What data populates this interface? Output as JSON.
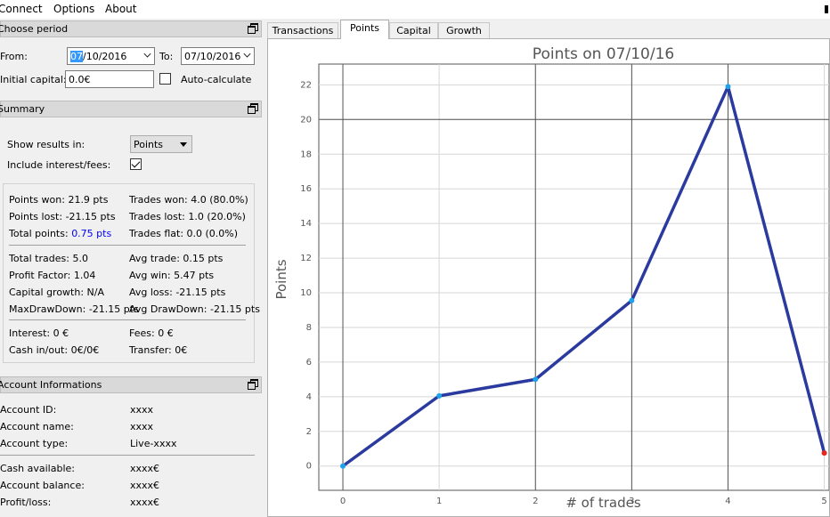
{
  "menu": {
    "items": [
      "Connect",
      "Options",
      "About"
    ]
  },
  "period": {
    "title": "Choose period",
    "from_label": "From:",
    "from_value_selected": "07",
    "from_value_rest": "/10/2016",
    "to_label": "To:",
    "to_value": "07/10/2016",
    "capital_label": "Initial capital:",
    "capital_value": "0.0€",
    "auto_label": "Auto-calculate",
    "auto_checked": false
  },
  "summary": {
    "title": "Summary",
    "show_label": "Show results in:",
    "show_value": "Points",
    "include_label": "Include interest/fees:",
    "include_checked": true,
    "stats": {
      "points_won": "Points won: 21.9 pts",
      "trades_won": "Trades won: 4.0 (80.0%)",
      "points_lost": "Points lost: -21.15 pts",
      "trades_lost": "Trades lost: 1.0 (20.0%)",
      "total_points_label": "Total points:",
      "total_points_value": "0.75 pts",
      "trades_flat": "Trades flat: 0.0 (0.0%)",
      "total_trades": "Total trades: 5.0",
      "avg_trade": "Avg trade: 0.15 pts",
      "profit_factor": "Profit Factor: 1.04",
      "avg_win": "Avg win: 5.47 pts",
      "capital_growth": "Capital growth: N/A",
      "avg_loss": "Avg loss: -21.15 pts",
      "max_drawdown": "MaxDrawDown: -21.15 pts",
      "avg_drawdown": "Avg DrawDown: -21.15 pts",
      "interest": "Interest: 0 €",
      "fees": "Fees: 0 €",
      "cash": "Cash in/out: 0€/0€",
      "transfer": "Transfer: 0€"
    }
  },
  "account": {
    "title": "Account Informations",
    "rows": [
      {
        "label": "Account ID:",
        "value": "xxxx"
      },
      {
        "label": "Account name:",
        "value": "xxxx"
      },
      {
        "label": "Account type:",
        "value": "Live-xxxx"
      }
    ],
    "rows2": [
      {
        "label": "Cash available:",
        "value": "xxxx€"
      },
      {
        "label": "Account balance:",
        "value": "xxxx€"
      },
      {
        "label": "Profit/loss:",
        "value": "xxxx€"
      }
    ]
  },
  "tabs": [
    "Transactions",
    "Points",
    "Capital",
    "Growth"
  ],
  "active_tab": "Points",
  "colors": {
    "line": "#2b3a9e",
    "point": "#1fa2e8",
    "last_point": "#e8251f",
    "selection": "#3399ff",
    "link_blue": "#0000ff"
  },
  "chart_data": {
    "type": "line",
    "title": "Points on 07/10/16",
    "xlabel": "# of trades",
    "ylabel": "Points",
    "x": [
      0,
      1,
      2,
      3,
      4,
      5
    ],
    "y": [
      0,
      4.05,
      5.0,
      9.55,
      21.9,
      0.75
    ],
    "xlim": [
      -0.25,
      5.05
    ],
    "ylim": [
      -1.4,
      23.2
    ],
    "xticks": [
      0,
      1,
      2,
      3,
      4,
      5
    ],
    "yticks": [
      0,
      2,
      4,
      6,
      8,
      10,
      12,
      14,
      16,
      18,
      20,
      22
    ],
    "major_vlines": [
      0,
      2,
      3,
      4
    ],
    "major_hlines": [
      20
    ],
    "grid": true
  }
}
